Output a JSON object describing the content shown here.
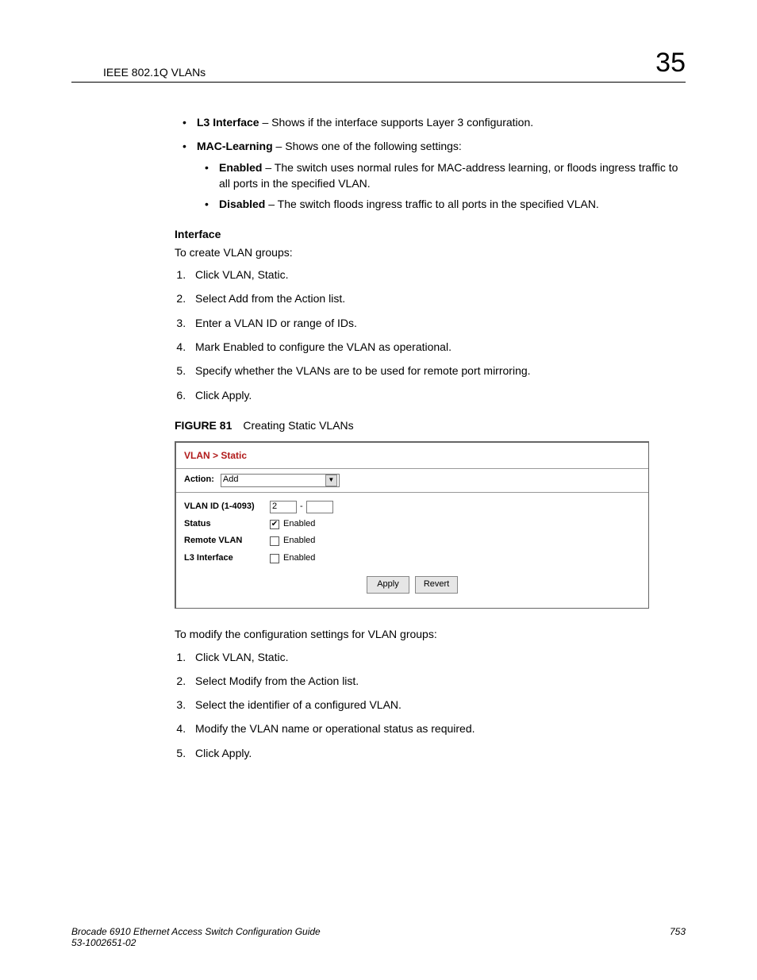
{
  "header": {
    "section": "IEEE 802.1Q VLANs",
    "chapter": "35"
  },
  "top_bullets": [
    {
      "term": "L3 Interface",
      "desc": " – Shows if the interface supports Layer 3 configuration."
    },
    {
      "term": "MAC-Learning",
      "desc": " – Shows one of the following settings:",
      "sub": [
        {
          "term": "Enabled",
          "desc": " – The switch uses normal rules for MAC-address learning, or floods ingress traffic to all ports in the specified VLAN."
        },
        {
          "term": "Disabled",
          "desc": " – The switch floods ingress traffic to all ports in the specified VLAN."
        }
      ]
    }
  ],
  "interface_heading": "Interface",
  "interface_intro": "To create VLAN groups:",
  "steps_create": [
    "Click VLAN, Static.",
    "Select Add from the Action list.",
    "Enter a VLAN ID or range of IDs.",
    "Mark Enabled to configure the VLAN as operational.",
    "Specify whether the VLANs are to be used for remote port mirroring.",
    "Click Apply."
  ],
  "figure": {
    "num": "FIGURE 81",
    "title": "Creating Static VLANs",
    "breadcrumb": "VLAN > Static",
    "action_label": "Action:",
    "action_value": "Add",
    "rows": {
      "vlan_id_label": "VLAN ID (1-4093)",
      "vlan_id_value": "2",
      "status_label": "Status",
      "remote_label": "Remote VLAN",
      "l3_label": "L3 Interface",
      "enabled_text": "Enabled"
    },
    "buttons": {
      "apply": "Apply",
      "revert": "Revert"
    }
  },
  "modify_intro": "To modify the configuration settings for VLAN groups:",
  "steps_modify": [
    "Click VLAN, Static.",
    "Select Modify from the Action list.",
    "Select the identifier of a configured VLAN.",
    "Modify the VLAN name or operational status as required.",
    "Click Apply."
  ],
  "footer": {
    "book": "Brocade 6910 Ethernet Access Switch Configuration Guide",
    "docnum": "53-1002651-02",
    "page": "753"
  }
}
